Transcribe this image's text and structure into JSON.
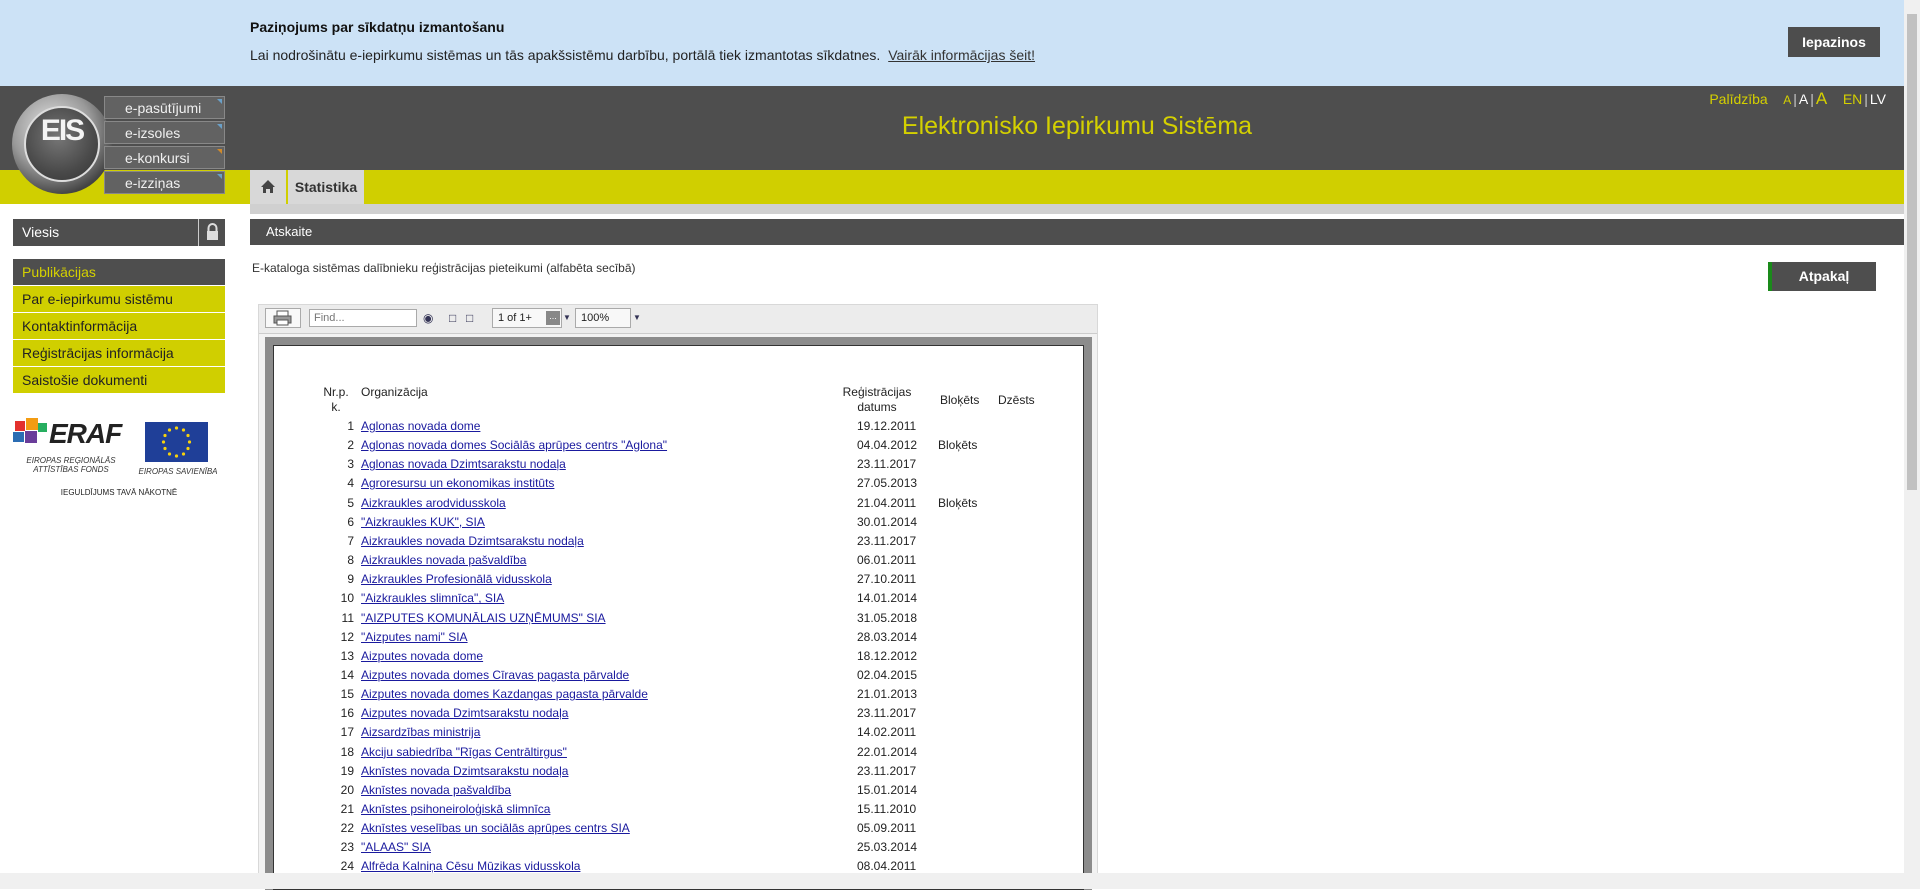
{
  "cookie": {
    "title": "Paziņojums par sīkdatņu izmantošanu",
    "text": "Lai nodrošinātu e-iepirkumu sistēmas un tās apakšsistēmu darbību, portālā tiek izmantotas sīkdatnes.",
    "link": "Vairāk informācijas šeit!",
    "button": "Iepazinos"
  },
  "header": {
    "title": "Elektronisko Iepirkumu Sistēma",
    "help": "Palīdzība",
    "font_small": "A",
    "font_medium": "A",
    "font_large": "A",
    "lang_en": "EN",
    "lang_lv": "LV",
    "logo_text": "EIS"
  },
  "emenu": [
    "e-pasūtījumi",
    "e-izsoles",
    "e-konkursi",
    "e-izziņas"
  ],
  "tabs": {
    "statistika": "Statistika"
  },
  "user": {
    "name": "Viesis"
  },
  "nav": [
    "Publikācijas",
    "Par e-iepirkumu sistēmu",
    "Kontaktinformācija",
    "Reģistrācijas informācija",
    "Saistošie dokumenti"
  ],
  "eraf": {
    "logo": "ERAF",
    "fund": "EIROPAS REĢIONĀLĀS ATTĪSTĪBAS FONDS",
    "eu": "EIROPAS SAVIENĪBA",
    "slogan": "IEGULDĪJUMS TAVĀ NĀKOTNĒ"
  },
  "main": {
    "section": "Atskaite",
    "subtitle": "E-kataloga sistēmas dalībnieku reģistrācijas pieteikumi (alfabēta secībā)",
    "back": "Atpakaļ"
  },
  "toolbar": {
    "find_placeholder": "Find...",
    "page": "1 of 1+",
    "zoom": "100%"
  },
  "report": {
    "headers": {
      "nr": "Nr.p.",
      "nr2": "k.",
      "org": "Organizācija",
      "date": "Reģistrācijas",
      "date2": "datums",
      "blocked": "Bloķēts",
      "deleted": "Dzēsts"
    },
    "rows": [
      {
        "n": "1",
        "org": "Aglonas novada dome",
        "date": "19.12.2011",
        "blocked": ""
      },
      {
        "n": "2",
        "org": "Aglonas novada domes Sociālās aprūpes centrs \"Aglona\"",
        "date": "04.04.2012",
        "blocked": "Bloķēts"
      },
      {
        "n": "3",
        "org": "Aglonas novada Dzimtsarakstu nodaļa",
        "date": "23.11.2017",
        "blocked": ""
      },
      {
        "n": "4",
        "org": "Agroresursu un ekonomikas institūts",
        "date": "27.05.2013",
        "blocked": ""
      },
      {
        "n": "5",
        "org": "Aizkraukles arodvidusskola",
        "date": "21.04.2011",
        "blocked": "Bloķēts"
      },
      {
        "n": "6",
        "org": "\"Aizkraukles KUK\", SIA",
        "date": "30.01.2014",
        "blocked": ""
      },
      {
        "n": "7",
        "org": "Aizkraukles novada Dzimtsarakstu nodaļa",
        "date": "23.11.2017",
        "blocked": ""
      },
      {
        "n": "8",
        "org": "Aizkraukles novada pašvaldība",
        "date": "06.01.2011",
        "blocked": ""
      },
      {
        "n": "9",
        "org": "Aizkraukles Profesionālā vidusskola",
        "date": "27.10.2011",
        "blocked": ""
      },
      {
        "n": "10",
        "org": "\"Aizkraukles slimnīca\", SIA",
        "date": "14.01.2014",
        "blocked": ""
      },
      {
        "n": "11",
        "org": "\"AIZPUTES KOMUNĀLAIS UZŅĒMUMS\" SIA",
        "date": "31.05.2018",
        "blocked": ""
      },
      {
        "n": "12",
        "org": "\"Aizputes nami\" SIA",
        "date": "28.03.2014",
        "blocked": ""
      },
      {
        "n": "13",
        "org": "Aizputes novada dome",
        "date": "18.12.2012",
        "blocked": ""
      },
      {
        "n": "14",
        "org": "Aizputes novada domes Cīravas pagasta pārvalde",
        "date": "02.04.2015",
        "blocked": ""
      },
      {
        "n": "15",
        "org": "Aizputes novada domes Kazdangas pagasta pārvalde",
        "date": "21.01.2013",
        "blocked": ""
      },
      {
        "n": "16",
        "org": "Aizputes novada Dzimtsarakstu nodaļa",
        "date": "23.11.2017",
        "blocked": ""
      },
      {
        "n": "17",
        "org": "Aizsardzības ministrija",
        "date": "14.02.2011",
        "blocked": ""
      },
      {
        "n": "18",
        "org": "Akciju sabiedrība \"Rīgas Centrāltirgus\"",
        "date": "22.01.2014",
        "blocked": ""
      },
      {
        "n": "19",
        "org": "Aknīstes novada Dzimtsarakstu nodaļa",
        "date": "23.11.2017",
        "blocked": ""
      },
      {
        "n": "20",
        "org": "Aknīstes novada pašvaldība",
        "date": "15.01.2014",
        "blocked": ""
      },
      {
        "n": "21",
        "org": "Aknīstes psihoneiroloģiskā slimnīca",
        "date": "15.11.2010",
        "blocked": ""
      },
      {
        "n": "22",
        "org": "Aknīstes veselības un sociālās aprūpes centrs SIA",
        "date": "05.09.2011",
        "blocked": ""
      },
      {
        "n": "23",
        "org": "\"ALAAS\" SIA",
        "date": "25.03.2014",
        "blocked": ""
      },
      {
        "n": "24",
        "org": "Alfrēda Kalniņa Cēsu Mūzikas vidusskola",
        "date": "08.04.2011",
        "blocked": ""
      }
    ]
  }
}
